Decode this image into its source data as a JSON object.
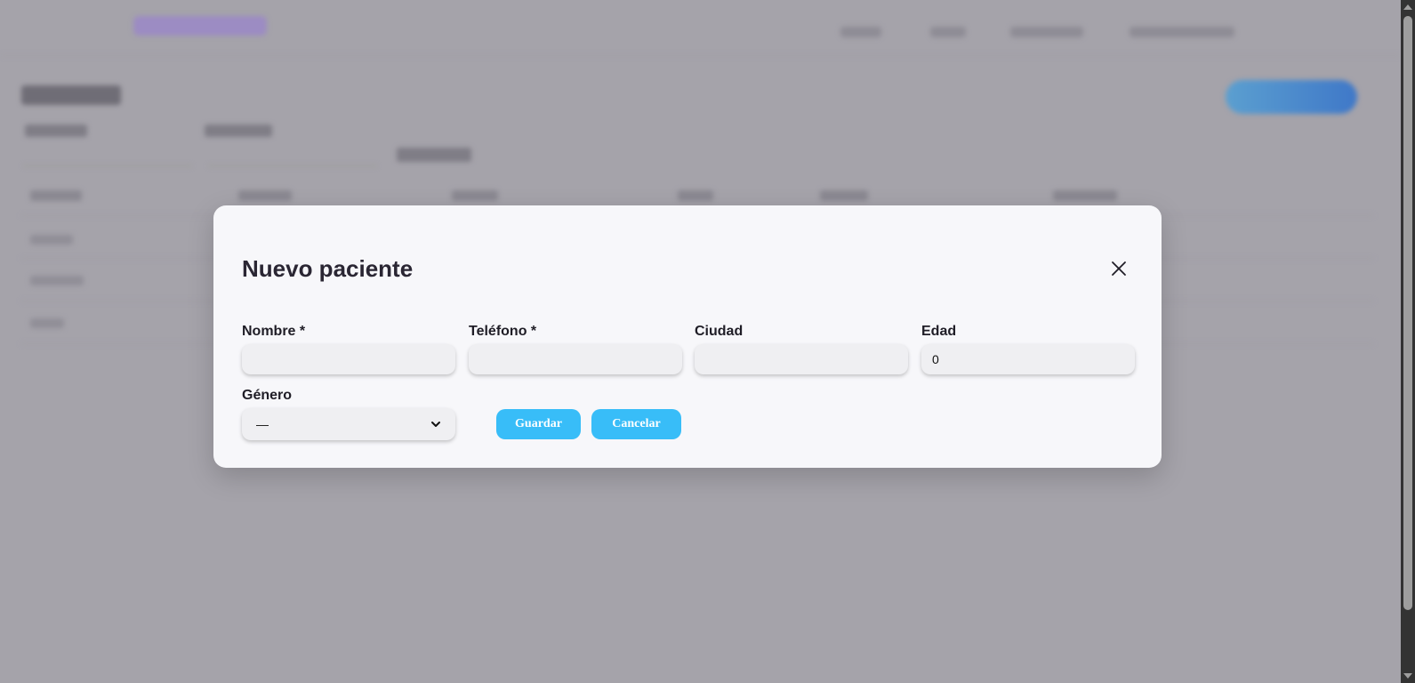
{
  "modal": {
    "title": "Nuevo paciente",
    "close_icon": "close-icon",
    "fields": {
      "nombre_label": "Nombre *",
      "nombre_value": "",
      "telefono_label": "Teléfono *",
      "telefono_value": "",
      "ciudad_label": "Ciudad",
      "ciudad_value": "",
      "edad_label": "Edad",
      "edad_value": "0",
      "genero_label": "Género",
      "genero_selected": "—"
    },
    "buttons": {
      "save_label": "Guardar",
      "cancel_label": "Cancelar"
    }
  },
  "colors": {
    "overlay": "#a5a3aa",
    "modal_background": "#f7f7fa",
    "button_accent": "#38bdf8",
    "input_background": "#efeff2"
  }
}
